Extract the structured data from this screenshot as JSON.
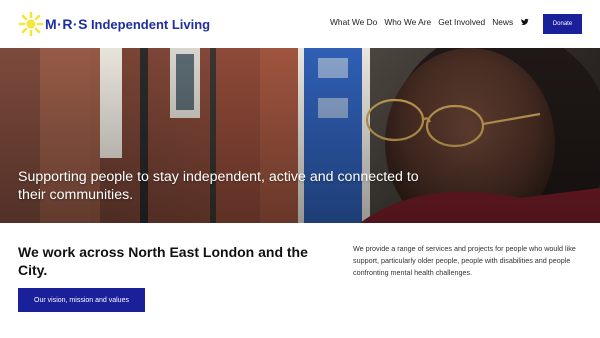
{
  "header": {
    "logo": {
      "mrs_text": "M·R·S",
      "name_text": "Independent Living",
      "icon": "sun-logo-icon",
      "colors": {
        "sun": "#f4e63a",
        "text": "#1f2ea0"
      }
    },
    "nav": [
      {
        "label": "What We Do"
      },
      {
        "label": "Who We Are"
      },
      {
        "label": "Get Involved"
      },
      {
        "label": "News"
      }
    ],
    "twitter_icon": "twitter-icon",
    "donate_label": "Donate"
  },
  "hero": {
    "text": "Supporting people to stay independent, active and connected to their communities."
  },
  "intro": {
    "heading": "We work across North East London and the City.",
    "button_label": "Our vision, mission and values",
    "description": "We provide a range of services and projects for people who would like support, particularly older people, people with disabilities and people confronting mental health challenges."
  },
  "colors": {
    "accent": "#1a1f9a",
    "door_blue": "#2f5fb5",
    "brick": "#9a4f3c"
  }
}
